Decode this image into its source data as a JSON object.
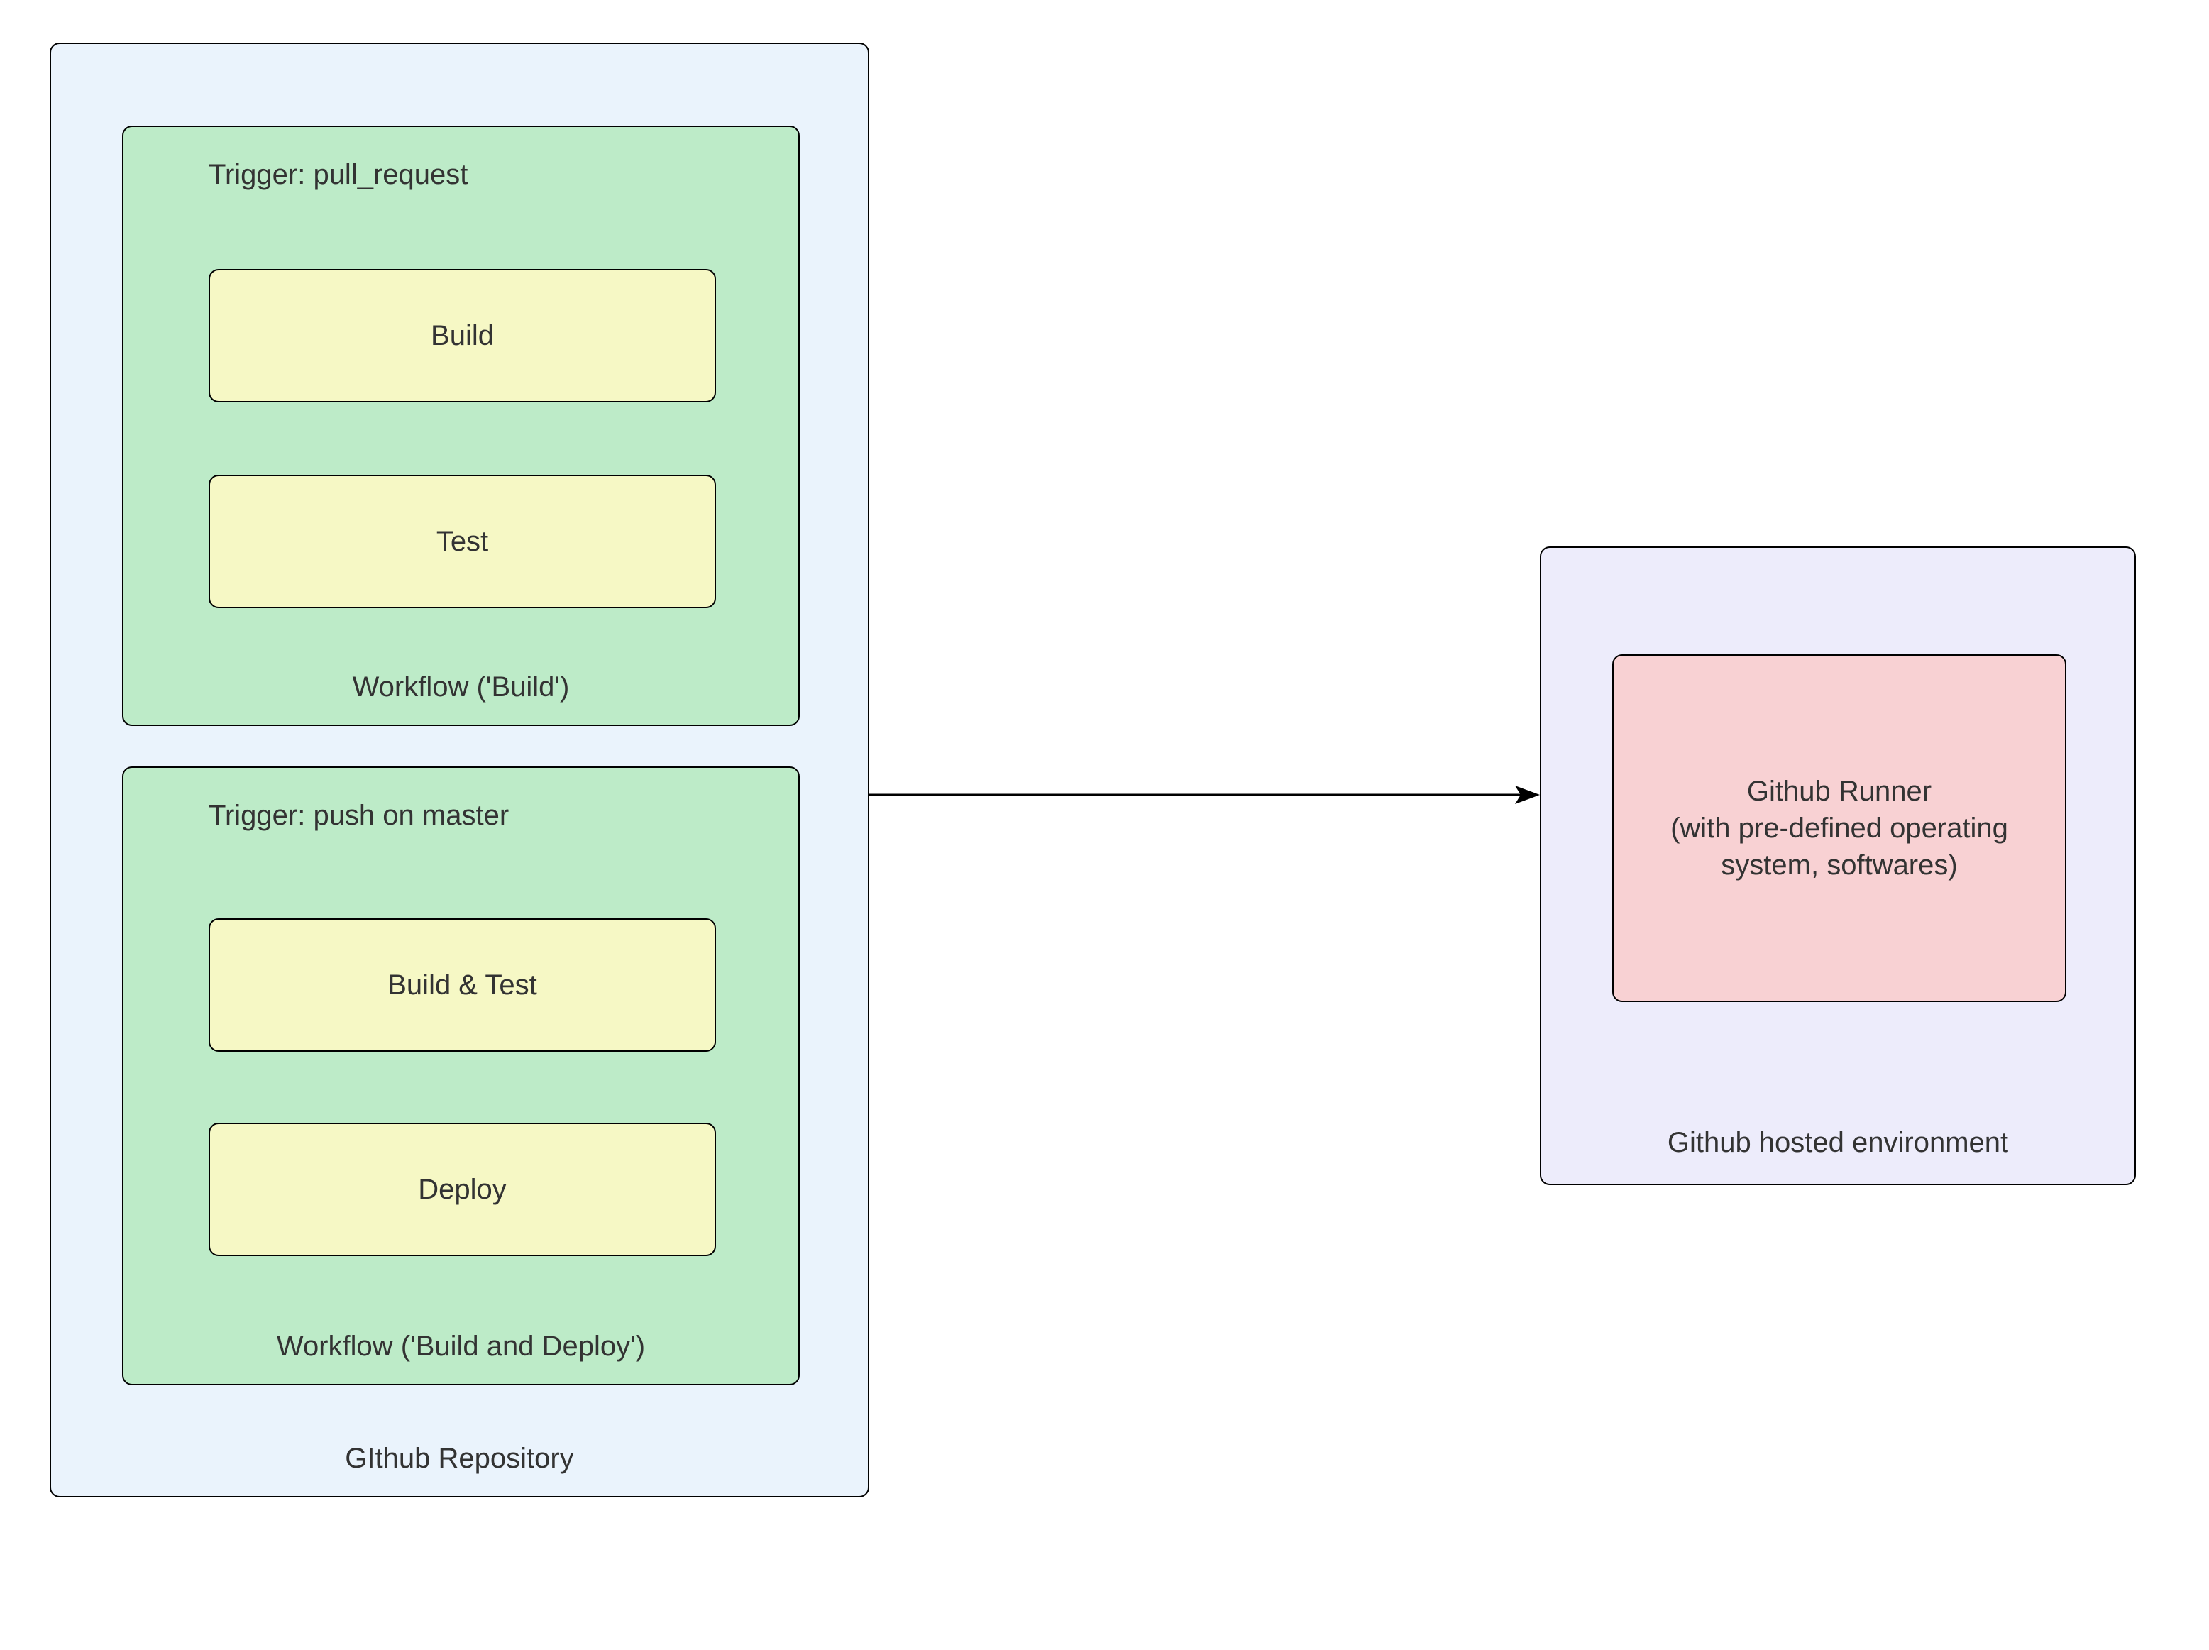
{
  "repository": {
    "label": "GIthub Repository",
    "workflows": [
      {
        "trigger": "Trigger: pull_request",
        "name": "Workflow ('Build')",
        "steps": [
          "Build",
          "Test"
        ]
      },
      {
        "trigger": "Trigger: push on master",
        "name": "Workflow ('Build and Deploy')",
        "steps": [
          "Build & Test",
          "Deploy"
        ]
      }
    ]
  },
  "environment": {
    "label": "Github hosted environment",
    "runner": "Github Runner\n(with pre-defined operating system, softwares)"
  }
}
